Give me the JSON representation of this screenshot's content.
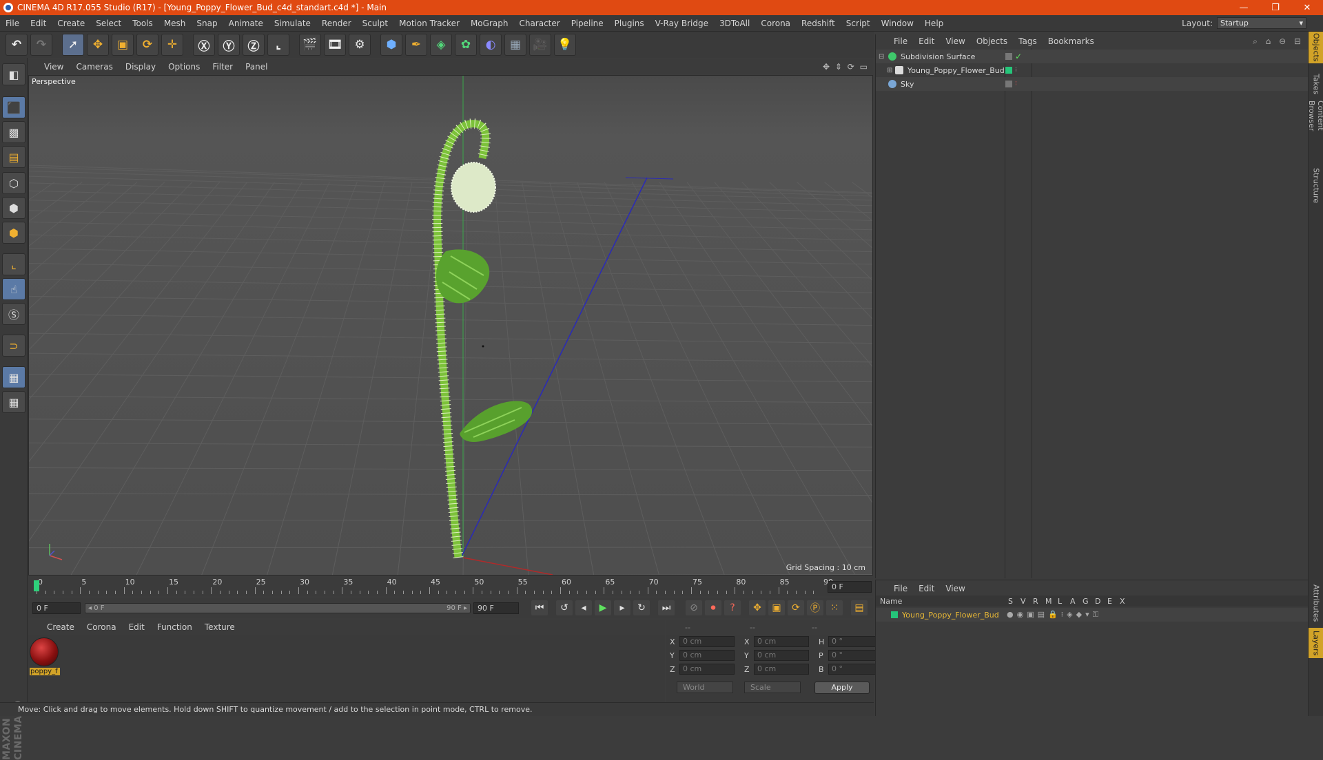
{
  "window": {
    "title": "CINEMA 4D R17.055 Studio (R17) - [Young_Poppy_Flower_Bud_c4d_standart.c4d *] - Main",
    "minimize": "—",
    "restore": "❐",
    "close": "✕"
  },
  "menu": [
    "File",
    "Edit",
    "Create",
    "Select",
    "Tools",
    "Mesh",
    "Snap",
    "Animate",
    "Simulate",
    "Render",
    "Sculpt",
    "Motion Tracker",
    "MoGraph",
    "Character",
    "Pipeline",
    "Plugins",
    "V-Ray Bridge",
    "3DToAll",
    "Corona",
    "Redshift",
    "Script",
    "Window",
    "Help"
  ],
  "layout": {
    "label": "Layout:",
    "value": "Startup"
  },
  "viewport": {
    "menu": [
      "View",
      "Cameras",
      "Display",
      "Options",
      "Filter",
      "Panel"
    ],
    "camera_label": "Perspective",
    "grid_spacing": "Grid Spacing : 10 cm",
    "nav_icons": "✥ ⇕ ⟳ ▭"
  },
  "timeline": {
    "ticks": [
      "0",
      "5",
      "10",
      "15",
      "20",
      "25",
      "30",
      "35",
      "40",
      "45",
      "50",
      "55",
      "60",
      "65",
      "70",
      "75",
      "80",
      "85",
      "90"
    ],
    "current_frame": "0 F",
    "start_field": "0 F",
    "range_start": "◂ 0 F",
    "range_end": "90 F ▸",
    "end_field": "90 F"
  },
  "materials": {
    "menu": [
      "Create",
      "Corona",
      "Edit",
      "Function",
      "Texture"
    ],
    "items": [
      {
        "name": "poppy_f"
      }
    ]
  },
  "coordinates": {
    "header": [
      "--",
      "--",
      "--"
    ],
    "rows": [
      {
        "a": "X",
        "av": "0 cm",
        "b": "X",
        "bv": "0 cm",
        "c": "H",
        "cv": "0 °"
      },
      {
        "a": "Y",
        "av": "0 cm",
        "b": "Y",
        "bv": "0 cm",
        "c": "P",
        "cv": "0 °"
      },
      {
        "a": "Z",
        "av": "0 cm",
        "b": "Z",
        "bv": "0 cm",
        "c": "B",
        "cv": "0 °"
      }
    ],
    "space": "World",
    "mode": "Scale",
    "apply": "Apply"
  },
  "status": "Move: Click and drag to move elements. Hold down SHIFT to quantize movement / add to the selection in point mode, CTRL to remove.",
  "objects": {
    "menu": [
      "File",
      "Edit",
      "View",
      "Objects",
      "Tags",
      "Bookmarks"
    ],
    "tree": [
      {
        "name": "Subdivision Surface",
        "icon_color": "#3fc96b"
      },
      {
        "name": "Young_Poppy_Flower_Bud",
        "icon_color": "#dcdcdc"
      },
      {
        "name": "Sky",
        "icon_color": "#7aa7d6"
      }
    ]
  },
  "layers": {
    "menu": [
      "File",
      "Edit",
      "View"
    ],
    "columns": [
      "Name",
      "S",
      "V",
      "R",
      "M",
      "L",
      "A",
      "G",
      "D",
      "E",
      "X"
    ],
    "rows": [
      {
        "name": "Young_Poppy_Flower_Bud",
        "color": "#25c57a"
      }
    ]
  },
  "side_tabs": [
    "Objects",
    "Takes",
    "Content Browser",
    "Structure",
    "Attributes",
    "Layers"
  ],
  "colors": {
    "title_bar": "#e04a12",
    "accent": "#d2a328",
    "selection": "#5c6f8e"
  },
  "toolbar_icons": [
    "undo-icon",
    "redo-icon",
    "live-select-icon",
    "move-icon",
    "scale-icon",
    "rotate-icon",
    "move-axis-icon",
    "x-axis-icon",
    "y-axis-icon",
    "z-axis-icon",
    "coordinate-system-icon",
    "render-view-icon",
    "render-picture-viewer-icon",
    "edit-render-settings-icon",
    "cube-icon",
    "pen-icon",
    "subdivision-icon",
    "cloner-icon",
    "deformer-icon",
    "floor-icon",
    "camera-icon",
    "light-icon"
  ]
}
